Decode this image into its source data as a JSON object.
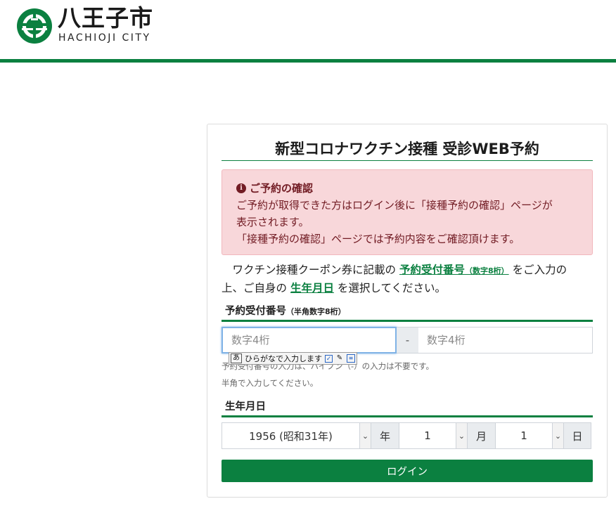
{
  "header": {
    "logo_ja": "八王子市",
    "logo_en": "HACHIOJI CITY"
  },
  "form": {
    "title": "新型コロナワクチン接種 受診WEB予約",
    "alert": {
      "title": "ご予約の確認",
      "line1": "ご予約が取得できた方はログイン後に「接種予約の確認」ページが",
      "line2": "表示されます。",
      "line3": "「接種予約の確認」ページでは予約内容をご確認頂けます。"
    },
    "intro": {
      "part1": "ワクチン接種クーポン券に記載の",
      "link1": "予約受付番号",
      "link1_small": "（数字8桁）",
      "part2": "をご入力の",
      "part3": "上、ご自身の",
      "link2": "生年月日",
      "part4": "を選択してください。"
    },
    "reservation": {
      "label": "予約受付番号",
      "label_sub": "（半角数字8桁）",
      "placeholder1": "数字4桁",
      "separator": "-",
      "placeholder2": "数字4桁",
      "help1": "予約受付番号の入力は、ハイフン（-）の入力は不要です。",
      "help2": "半角で入力してください。"
    },
    "ime": {
      "mode_char": "あ",
      "text": "ひらがなで入力します"
    },
    "birthdate": {
      "label": "生年月日",
      "year": "1956 (昭和31年)",
      "year_unit": "年",
      "month": "1",
      "month_unit": "月",
      "day": "1",
      "day_unit": "日"
    },
    "login_label": "ログイン"
  },
  "colors": {
    "brand_green": "#0b8040",
    "alert_bg": "#f8d7da",
    "alert_text": "#721c24"
  }
}
